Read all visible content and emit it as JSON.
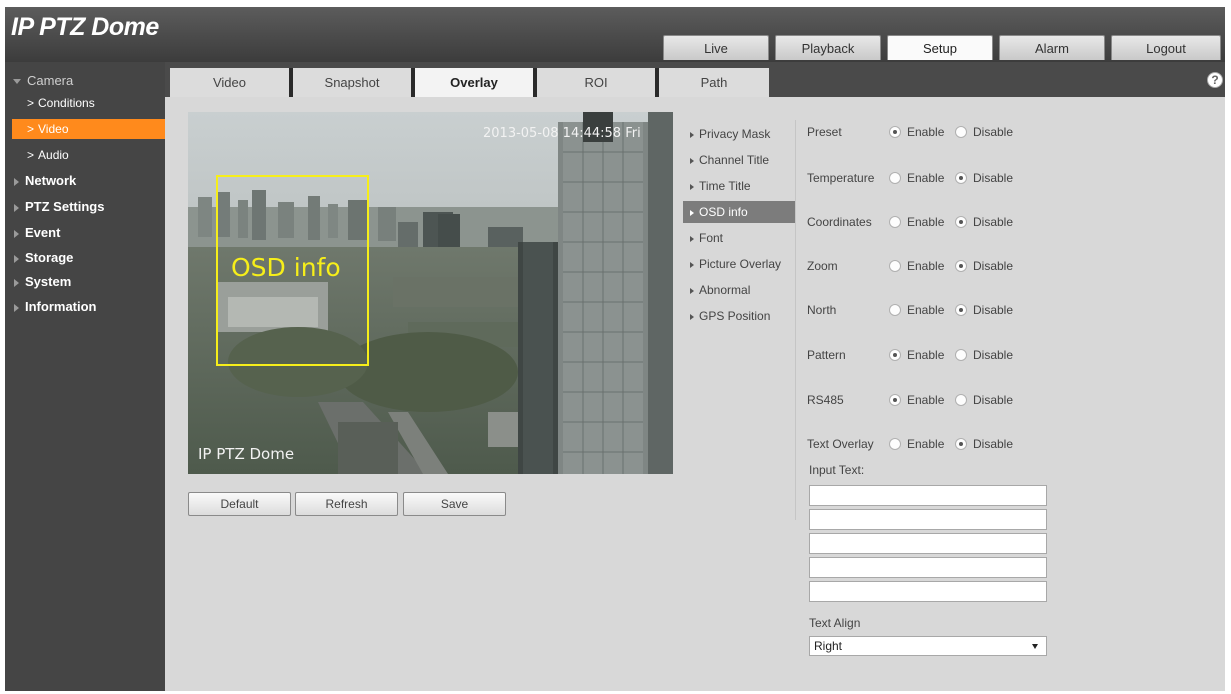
{
  "app": {
    "title": "IP PTZ Dome"
  },
  "top_nav": [
    "Live",
    "Playback",
    "Setup",
    "Alarm",
    "Logout"
  ],
  "top_nav_active": "Setup",
  "sidebar": {
    "camera": "Camera",
    "camera_sub": [
      "Conditions",
      "Video",
      "Audio"
    ],
    "camera_sub_active": "Video",
    "items": [
      "Network",
      "PTZ Settings",
      "Event",
      "Storage",
      "System",
      "Information"
    ]
  },
  "sub_tabs": [
    "Video",
    "Snapshot",
    "Overlay",
    "ROI",
    "Path"
  ],
  "sub_tab_active": "Overlay",
  "help_icon": "?",
  "video": {
    "timestamp": "2013-05-08 14:44:58 Fri",
    "channel_title": "IP PTZ Dome",
    "osd_label": "OSD info"
  },
  "buttons": {
    "default": "Default",
    "refresh": "Refresh",
    "save": "Save"
  },
  "osd_menu": [
    "Privacy Mask",
    "Channel Title",
    "Time Title",
    "OSD info",
    "Font",
    "Picture Overlay",
    "Abnormal",
    "GPS Position"
  ],
  "osd_menu_active": "OSD info",
  "radio_labels": {
    "enable": "Enable",
    "disable": "Disable"
  },
  "settings": [
    {
      "label": "Preset",
      "value": "Enable"
    },
    {
      "label": "Temperature",
      "value": "Disable"
    },
    {
      "label": "Coordinates",
      "value": "Disable"
    },
    {
      "label": "Zoom",
      "value": "Disable"
    },
    {
      "label": "North",
      "value": "Disable"
    },
    {
      "label": "Pattern",
      "value": "Enable"
    },
    {
      "label": "RS485",
      "value": "Enable"
    },
    {
      "label": "Text Overlay",
      "value": "Disable"
    }
  ],
  "input_text": {
    "label": "Input Text:",
    "values": [
      "",
      "",
      "",
      "",
      ""
    ]
  },
  "text_align": {
    "label": "Text Align",
    "value": "Right"
  },
  "colors": {
    "accent": "#ff8a1c",
    "osd_box": "#f6ee1a"
  }
}
